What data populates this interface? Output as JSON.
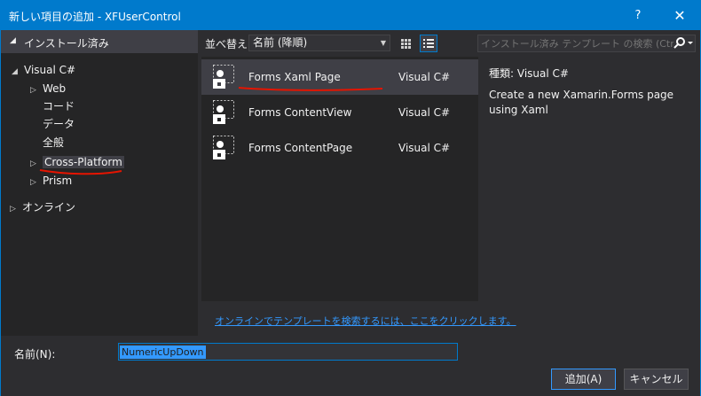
{
  "window": {
    "title": "新しい項目の追加 - XFUserControl",
    "help_label": "?",
    "close_label": "✕"
  },
  "left_pane": {
    "header_label": "インストール済み",
    "tree": [
      {
        "label": "Visual C#",
        "expander": "◢",
        "level": 0
      },
      {
        "label": "Web",
        "expander": "▷",
        "level": 1
      },
      {
        "label": "コード",
        "expander": "",
        "level": 1
      },
      {
        "label": "データ",
        "expander": "",
        "level": 1
      },
      {
        "label": "全般",
        "expander": "",
        "level": 1
      },
      {
        "label": "Cross-Platform",
        "expander": "▷",
        "level": 1,
        "selected": true
      },
      {
        "label": "Prism",
        "expander": "▷",
        "level": 1
      },
      {
        "label": "オンライン",
        "expander": "▷",
        "level": 0
      }
    ]
  },
  "toolbar": {
    "sort_label": "並べ替え:",
    "sort_value": "名前 (降順)"
  },
  "templates": [
    {
      "name": "Forms Xaml Page",
      "language": "Visual C#",
      "selected": true
    },
    {
      "name": "Forms ContentView",
      "language": "Visual C#",
      "selected": false
    },
    {
      "name": "Forms ContentPage",
      "language": "Visual C#",
      "selected": false
    }
  ],
  "online_link": "オンラインでテンプレートを検索するには、ここをクリックします。",
  "search": {
    "placeholder": "インストール済み テンプレート の検索 (Ctrl+E)"
  },
  "details": {
    "type_label": "種類:",
    "type_value": "Visual C#",
    "description": "Create a new Xamarin.Forms page using Xaml"
  },
  "bottom": {
    "name_label": "名前(N):",
    "name_value": "NumericUpDown",
    "add_button": "追加(A)",
    "cancel_button": "キャンセル"
  },
  "colors": {
    "accent": "#007acc",
    "annotation": "#e51400",
    "link": "#3399ff"
  }
}
